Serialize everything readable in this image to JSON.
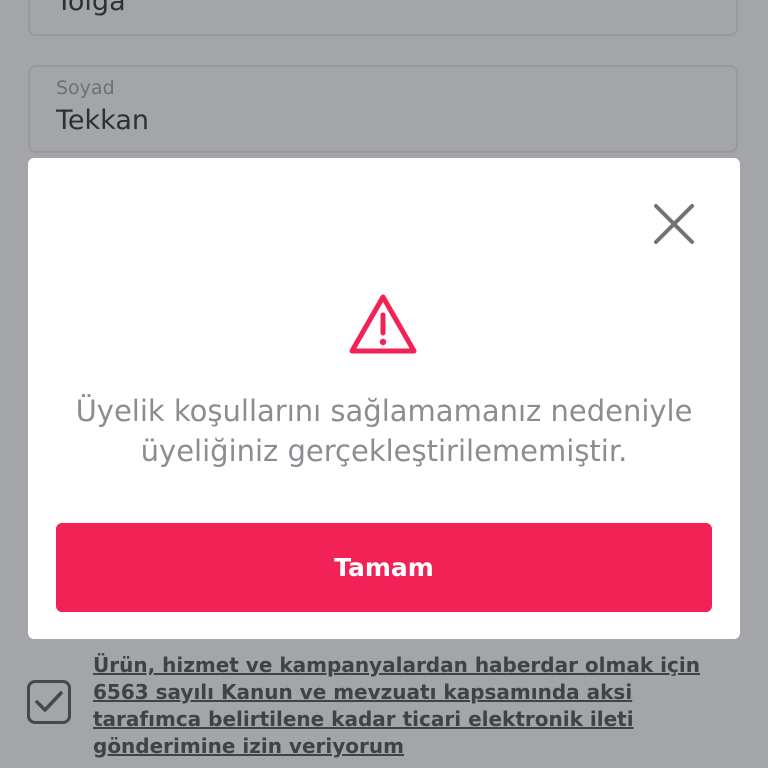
{
  "form": {
    "name_value": "Tolga",
    "surname_label": "Soyad",
    "surname_value": "Tekkan"
  },
  "modal": {
    "close_icon": "close-icon",
    "warning_icon": "warning-triangle-icon",
    "message_line1": "Üyelik koşullarını sağlamamanız nedeniyle",
    "message_line2": "üyeliğiniz gerçekleştirilememiştir.",
    "ok_label": "Tamam"
  },
  "consent": {
    "checked": true,
    "line1": "Ürün, hizmet ve kampanyalardan haberdar olmak için",
    "line2": "6563 sayılı Kanun ve mevzuatı kapsamında aksi",
    "line3": "tarafımca belirtilene kadar ticari elektronik ileti",
    "line4": "gönderimine izin veriyorum"
  },
  "colors": {
    "overlay": "#a3a5a9",
    "accent": "#f22156",
    "message_text": "#8a8d91"
  }
}
